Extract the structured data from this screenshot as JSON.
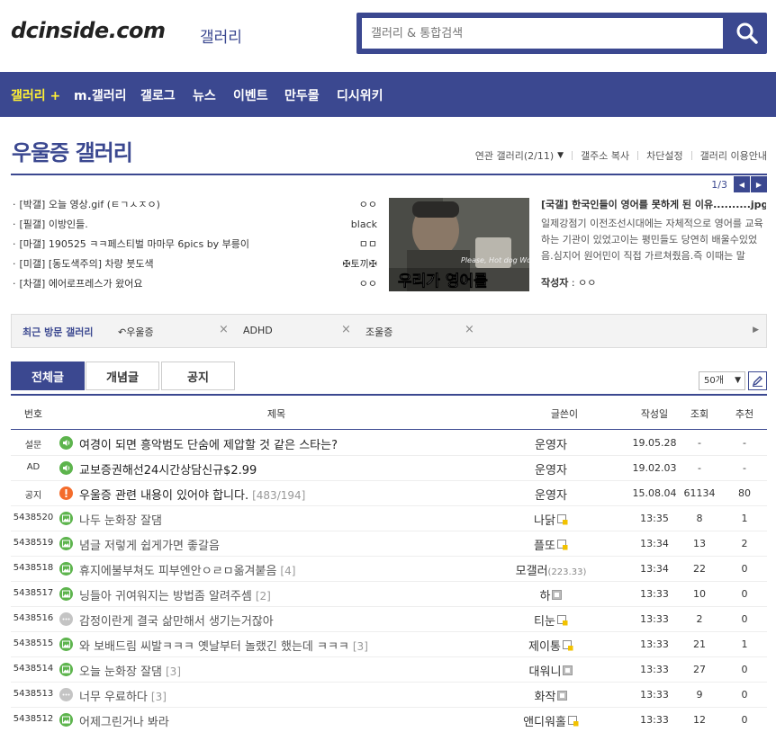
{
  "header": {
    "logo": "dcinside.com",
    "logo_sub": "갤러리",
    "search_placeholder": "갤러리 & 통합검색"
  },
  "nav": {
    "items": [
      "갤러리 +",
      "m.갤러리",
      "갤로그",
      "뉴스",
      "이벤트",
      "만두몰",
      "디시위키"
    ]
  },
  "gallery": {
    "title": "우울증 갤러리",
    "links": [
      "연관 갤러리(2/11)",
      "갤주소 복사",
      "차단설정",
      "갤러리 이용안내"
    ]
  },
  "concept": {
    "pager": "1/3",
    "items": [
      {
        "title": "[박갤] 오늘 영상.gif (ㅌㄱㅅㅈㅇ)",
        "author": "ㅇㅇ"
      },
      {
        "title": "[필갤] 이방인들.",
        "author": "black"
      },
      {
        "title": "[마갤] 190525 ㅋㅋ페스티벌 마마무 6pics by 부릉이",
        "author": "ㅁㅁ"
      },
      {
        "title": "[미갤] [동도색주의] 차량 붓도색",
        "author": "✠토끼✠"
      },
      {
        "title": "[차갤] 에어로프레스가 왔어요",
        "author": "ㅇㅇ"
      }
    ],
    "featured": {
      "title": "[국갤] 한국인들이 영어를 못하게 된 이유..........jpg",
      "body": "일제강점기 이전조선시대에는 자체적으로 영어를 교육하는 기관이 있었고이는 평민들도 당연히 배울수있었음.심지어 원어민이 직접 가르쳐줬음.즉 이때는 말",
      "author_label": "작성자",
      "author": "ㅇㅇ",
      "thumb_caption": "우리가 영어를",
      "thumb_subtitle": "Please, Hot dog World"
    }
  },
  "recent": {
    "label": "최근 방문 갤러리",
    "items": [
      "우울증",
      "ADHD",
      "조울증"
    ]
  },
  "tabs": [
    "전체글",
    "개념글",
    "공지"
  ],
  "list_size": "50개",
  "table": {
    "headers": [
      "번호",
      "제목",
      "글쓴이",
      "작성일",
      "조회",
      "추천"
    ],
    "rows": [
      {
        "num": "설문",
        "icon": "speaker",
        "title": "여경이 되면 흥악범도 단숨에 제압할 것 같은 스타는?",
        "count": "",
        "writer": "운영자",
        "ip": "",
        "date": "19.05.28",
        "views": "-",
        "rec": "-",
        "bold": true
      },
      {
        "num": "AD",
        "icon": "speaker",
        "title": "교보증권해선24시간상담신규$2.99",
        "count": "",
        "writer": "운영자",
        "ip": "",
        "date": "19.02.03",
        "views": "-",
        "rec": "-",
        "bold": true
      },
      {
        "num": "공지",
        "icon": "info",
        "title": "우울증 관련 내용이 있어야 합니다.",
        "count": "[483/194]",
        "writer": "운영자",
        "ip": "",
        "date": "15.08.04",
        "views": "61134",
        "rec": "80",
        "bold": true
      },
      {
        "num": "5438520",
        "icon": "image",
        "title": "나두 눈화장 잘댐",
        "count": "",
        "writer": "나닭",
        "ip": "",
        "date": "13:35",
        "views": "8",
        "rec": "1",
        "badge": "fixed"
      },
      {
        "num": "5438519",
        "icon": "image",
        "title": "념글 저렇게 쉽게가면 좋갈음",
        "count": "",
        "writer": "플또",
        "ip": "",
        "date": "13:34",
        "views": "13",
        "rec": "2",
        "badge": "fixed"
      },
      {
        "num": "5438518",
        "icon": "image",
        "title": "휴지에불부쳐도 피부엔안ㅇㄹㅁ옮겨붙음",
        "count": "[4]",
        "writer": "모갤러",
        "ip": "(223.33)",
        "date": "13:34",
        "views": "22",
        "rec": "0"
      },
      {
        "num": "5438517",
        "icon": "image",
        "title": "닝들아 귀여워지는 방법좀 알려주셈",
        "count": "[2]",
        "writer": "하",
        "ip": "",
        "date": "13:33",
        "views": "10",
        "rec": "0",
        "badge": "half"
      },
      {
        "num": "5438516",
        "icon": "chat",
        "title": "감정이란게 결국 삶만해서 생기는거잖아",
        "count": "",
        "writer": "티눈",
        "ip": "",
        "date": "13:33",
        "views": "2",
        "rec": "0",
        "badge": "fixed"
      },
      {
        "num": "5438515",
        "icon": "image",
        "title": "와 보배드림 씨발ㅋㅋㅋ 옛날부터 놀랬긴 했는데 ㅋㅋㅋ",
        "count": "[3]",
        "writer": "제이통",
        "ip": "",
        "date": "13:33",
        "views": "21",
        "rec": "1",
        "badge": "fixed"
      },
      {
        "num": "5438514",
        "icon": "image",
        "title": "오늘 눈화장 잘댐",
        "count": "[3]",
        "writer": "대워니",
        "ip": "",
        "date": "13:33",
        "views": "27",
        "rec": "0",
        "badge": "half"
      },
      {
        "num": "5438513",
        "icon": "chat",
        "title": "너무 우료하다",
        "count": "[3]",
        "writer": "화작",
        "ip": "",
        "date": "13:33",
        "views": "9",
        "rec": "0",
        "badge": "half"
      },
      {
        "num": "5438512",
        "icon": "image",
        "title": "어제그린거나 봐라",
        "count": "",
        "writer": "앤디워홀",
        "ip": "",
        "date": "13:33",
        "views": "12",
        "rec": "0",
        "badge": "fixed"
      }
    ]
  },
  "colors": {
    "brand": "#3b4890",
    "nav_active": "#fff034",
    "icon_green": "#5db44d",
    "icon_orange": "#f46c2b",
    "icon_gray": "#c4c4c4"
  }
}
